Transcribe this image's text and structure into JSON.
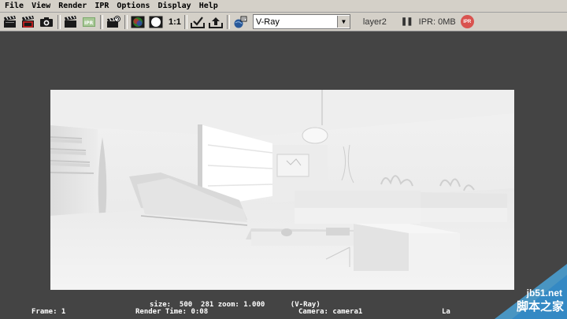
{
  "menu": [
    "File",
    "View",
    "Render",
    "IPR",
    "Options",
    "Display",
    "Help"
  ],
  "toolbar": {
    "ratio_label": "1:1",
    "renderer_value": "V-Ray",
    "layer_label": "layer2",
    "ipr_memory": "IPR: 0MB",
    "ipr_badge": "IPR",
    "icons": [
      "clapper-redo-icon",
      "clapper-region-icon",
      "snapshot-camera-icon",
      "clapper-icon",
      "ipr-render-icon",
      "refresh-ipr-icon",
      "rgb-channel-icon",
      "alpha-channel-icon",
      "keep-image-icon",
      "remove-image-icon",
      "render-globals-icon"
    ]
  },
  "hud": {
    "size_line": "size:  500  281 zoom: 1.000      (V-Ray)",
    "frame": "Frame: 1",
    "render_time": "Render Time: 0:08",
    "camera": "Camera: camera1",
    "layer_cut": "La"
  },
  "watermark": {
    "site": "jb51.net",
    "name": "脚本之家"
  }
}
